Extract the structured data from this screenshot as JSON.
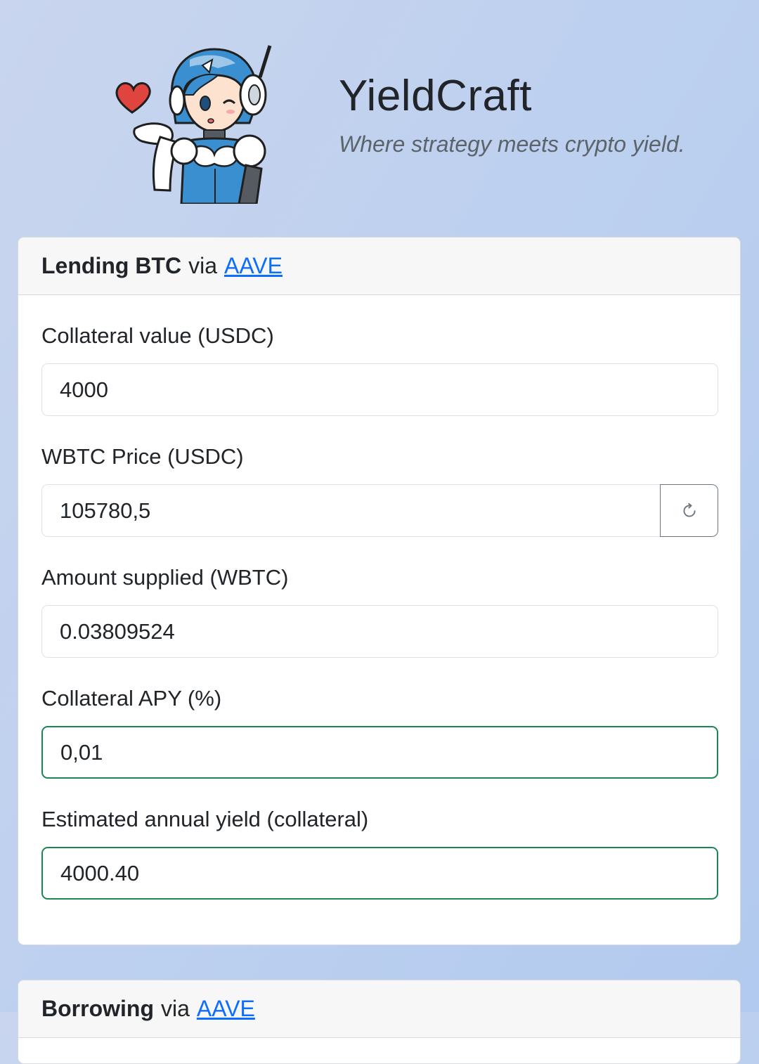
{
  "app": {
    "title": "YieldCraft",
    "subtitle": "Where strategy meets crypto yield."
  },
  "lending": {
    "title_strong": "Lending BTC",
    "title_via": "via",
    "protocol_link": "AAVE",
    "fields": {
      "collateral_value": {
        "label": "Collateral value (USDC)",
        "value": "4000"
      },
      "wbtc_price": {
        "label": "WBTC Price (USDC)",
        "value": "105780,5"
      },
      "amount_supplied": {
        "label": "Amount supplied (WBTC)",
        "value": "0.03809524"
      },
      "collateral_apy": {
        "label": "Collateral APY (%)",
        "value": "0,01"
      },
      "annual_yield": {
        "label": "Estimated annual yield (collateral)",
        "value": "4000.40"
      }
    },
    "refresh_icon": "refresh-icon"
  },
  "borrowing": {
    "title_strong": "Borrowing",
    "title_via": "via",
    "protocol_link": "AAVE"
  },
  "colors": {
    "link": "#0d6efd",
    "valid_border": "#198754",
    "accent_blue": "#2f8fd6"
  }
}
